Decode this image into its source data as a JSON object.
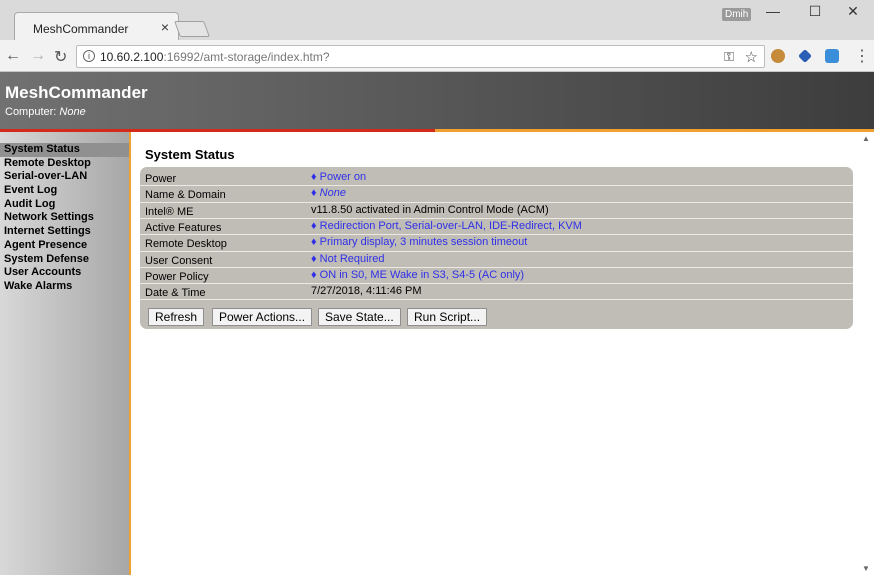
{
  "browser": {
    "tab_title": "MeshCommander",
    "tab_close": "×",
    "user_badge": "Dmih",
    "url_host": "10.60.2.100",
    "url_rest": ":16992/amt-storage/index.htm?",
    "info_icon": "i",
    "controls": {
      "minimize": "—",
      "maximize": "☐",
      "close": "✕",
      "back": "←",
      "forward": "→",
      "reload": "↻",
      "key": "⚿",
      "star": "☆",
      "menu": "⋮"
    }
  },
  "header": {
    "title": "MeshCommander",
    "computer_label": "Computer: ",
    "computer_value": "None"
  },
  "sidebar": {
    "items": [
      "System Status",
      "Remote Desktop",
      "Serial-over-LAN",
      "Event Log",
      "Audit Log",
      "Network Settings",
      "Internet Settings",
      "Agent Presence",
      "System Defense",
      "User Accounts",
      "Wake Alarms"
    ]
  },
  "main": {
    "title": "System Status",
    "rows": [
      {
        "label": "Power",
        "value": "♦ Power on"
      },
      {
        "label": "Name & Domain",
        "value": "♦ None"
      },
      {
        "label": "Intel® ME",
        "value": "v11.8.50 activated in Admin Control Mode (ACM)"
      },
      {
        "label": "Active Features",
        "value": "♦ Redirection Port, Serial-over-LAN, IDE-Redirect, KVM"
      },
      {
        "label": "Remote Desktop",
        "value": "♦ Primary display, 3 minutes session timeout"
      },
      {
        "label": "User Consent",
        "value": "♦ Not Required"
      },
      {
        "label": "Power Policy",
        "value": "♦ ON in S0, ME Wake in S3, S4-5 (AC only)"
      },
      {
        "label": "Date & Time",
        "value": "7/27/2018, 4:11:46 PM"
      }
    ],
    "buttons": {
      "refresh": "Refresh",
      "power_actions": "Power Actions...",
      "save_state": "Save State...",
      "run_script": "Run Script..."
    }
  },
  "colors": {
    "link": "#2f2fe8",
    "accent_red": "#d42a1a",
    "accent_orange": "#f0a030"
  }
}
